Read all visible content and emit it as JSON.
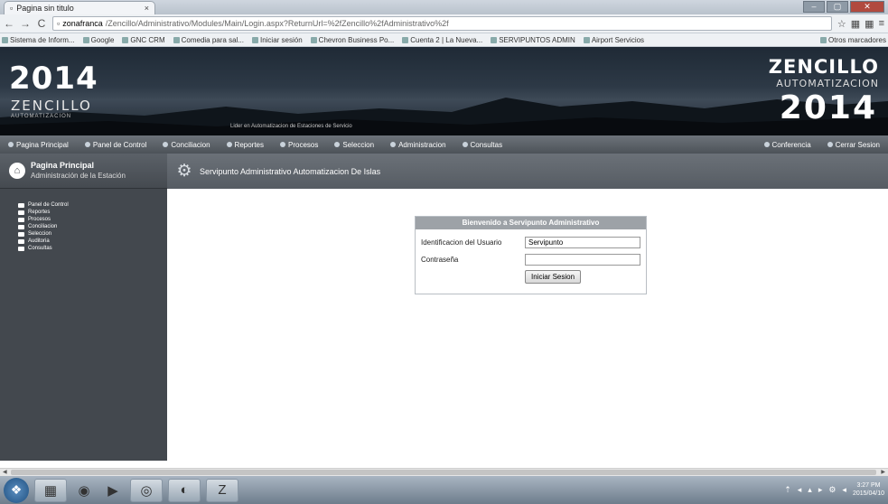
{
  "browser": {
    "tab_title": "Pagina sin titulo",
    "tab_close": "×",
    "window_controls": [
      "–",
      "▢",
      "✕"
    ],
    "nav": {
      "back": "←",
      "forward": "→",
      "reload": "C"
    },
    "url_domain": "zonafranca",
    "url_path": "/Zencillo/Administrativo/Modules/Main/Login.aspx?ReturnUrl=%2fZencillo%2fAdministrativo%2f",
    "toolbar_icons": [
      "☆",
      "▦",
      "▦",
      "≡"
    ],
    "bookmarks": [
      "Sistema de Inform...",
      "Google",
      "GNC CRM",
      "Comedia para sal...",
      "Iniciar sesión",
      "Chevron Business Po...",
      "Cuenta 2 | La Nueva...",
      "SERVIPUNTOS ADMIN",
      "Airport Servicios"
    ],
    "other_bookmarks": "Otros marcadores"
  },
  "header": {
    "year_left": "2014",
    "brand_left": "ZENCILLO",
    "brand_left_sub": "AUTOMATIZACION",
    "tagline": "Lider en Automatizacion de Estaciones de Servicio",
    "brand_right": "ZENCILLO",
    "brand_right_sub": "AUTOMATIZACION",
    "year_right": "2014"
  },
  "mainnav": {
    "items": [
      "Pagina Principal",
      "Panel de Control",
      "Conciliacion",
      "Reportes",
      "Procesos",
      "Seleccion",
      "Administracion",
      "Consultas"
    ],
    "right_items": [
      "Conferencia",
      "Cerrar Sesion"
    ]
  },
  "sidebar": {
    "title": "Pagina Principal",
    "subtitle": "Administración de la Estación",
    "items": [
      "Panel de Control",
      "Reportes",
      "Procesos",
      "Conciliacion",
      "Seleccion",
      "Auditoria",
      "Consultas"
    ]
  },
  "content": {
    "title": "Servipunto Administrativo Automatizacion De Islas"
  },
  "login": {
    "title": "Bienvenido a Servipunto Administrativo",
    "user_label": "Identificacion del Usuario",
    "user_value": "Servipunto",
    "password_label": "Contraseña",
    "password_value": "",
    "button": "Iniciar Sesion"
  },
  "taskbar": {
    "start": "❖",
    "apps": [
      "▦",
      "◉",
      "▶",
      "◎",
      "◐",
      "Z"
    ],
    "tray_icons": [
      "⇡",
      "◂",
      "▴",
      "▸",
      "⚙",
      "◂"
    ],
    "time": "3:27 PM",
    "date": "2015/04/10"
  }
}
